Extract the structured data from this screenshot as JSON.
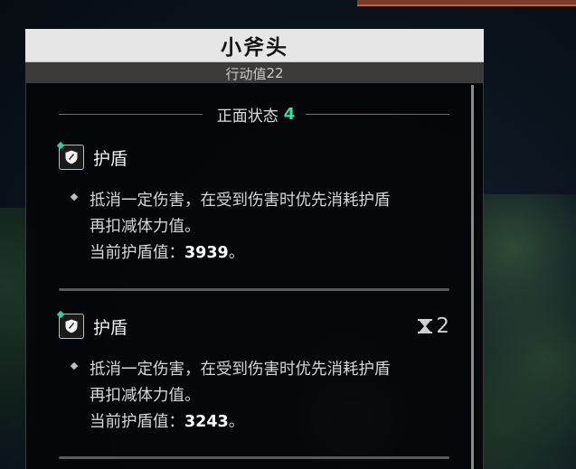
{
  "window": {
    "title": "小斧头",
    "subtitle_prefix": "行动值 ",
    "action_value": "22"
  },
  "section": {
    "title": "正面状态",
    "count": "4"
  },
  "effects": [
    {
      "name": "护盾",
      "icon": "shield-icon",
      "stack": "",
      "desc_line1": "抵消一定伤害，在受到伤害时优先消耗护盾",
      "desc_line2": "再扣减体力值。",
      "value_prefix": "当前护盾值：",
      "value": "3939",
      "value_suffix": "。"
    },
    {
      "name": "护盾",
      "icon": "shield-icon",
      "stack_icon": "hourglass-icon",
      "stack": "2",
      "desc_line1": "抵消一定伤害，在受到伤害时优先消耗护盾",
      "desc_line2": "再扣减体力值。",
      "value_prefix": "当前护盾值：",
      "value": "3243",
      "value_suffix": "。"
    }
  ],
  "colors": {
    "accent": "#35e0a0",
    "panel_bg": "#040609",
    "title_bar": "#e6e6e6",
    "subtitle_bar": "#3b3b3b"
  }
}
